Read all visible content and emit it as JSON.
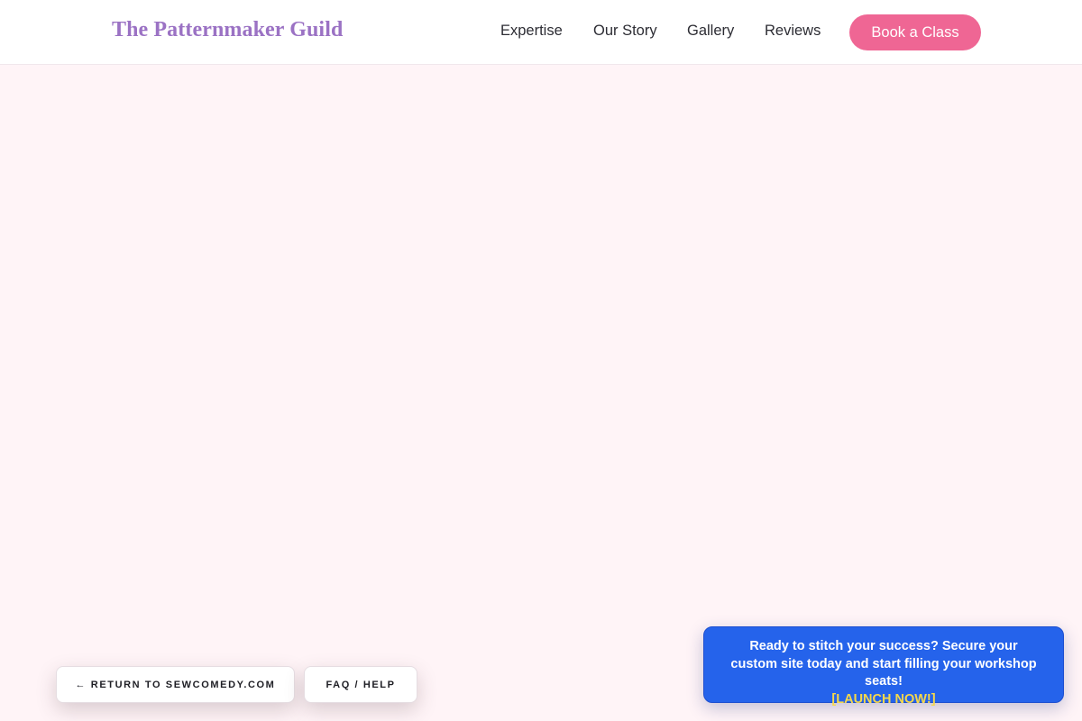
{
  "header": {
    "brand": "The Patternmaker Guild",
    "nav": [
      {
        "label": "Expertise"
      },
      {
        "label": "Our Story"
      },
      {
        "label": "Gallery"
      },
      {
        "label": "Reviews"
      }
    ],
    "cta_label": "Book a Class"
  },
  "footer_buttons": {
    "return_label": "← RETURN TO SEWCOMEDY.COM",
    "faq_label": "FAQ / HELP"
  },
  "promo": {
    "message": "Ready to stitch your success? Secure your custom site today and start filling your workshop seats!",
    "cta": "[LAUNCH NOW!]"
  },
  "colors": {
    "page_background": "#fff4f7",
    "brand": "#9b72c4",
    "accent_pink": "#ef6694",
    "promo_blue": "#2563eb",
    "promo_cta_yellow": "#f6d84a"
  }
}
